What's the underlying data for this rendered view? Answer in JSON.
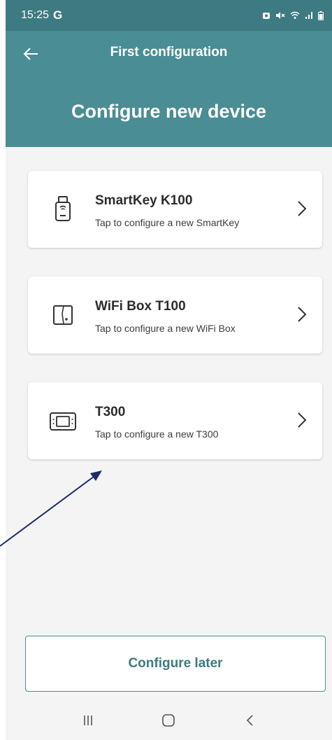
{
  "status_bar": {
    "time": "15:25",
    "g_label": "G",
    "icons": [
      "alarm-icon",
      "mute-icon",
      "wifi-icon",
      "signal-icon",
      "battery-icon"
    ]
  },
  "app_bar": {
    "title": "First configuration",
    "heading": "Configure new device",
    "color": "#4a8d94"
  },
  "devices": [
    {
      "icon": "smartkey-icon",
      "title": "SmartKey K100",
      "subtitle": "Tap to configure a new SmartKey"
    },
    {
      "icon": "wifi-box-icon",
      "title": "WiFi Box T100",
      "subtitle": "Tap to configure a new WiFi Box"
    },
    {
      "icon": "thermostat-icon",
      "title": "T300",
      "subtitle": "Tap to configure a new T300"
    }
  ],
  "configure_later_label": "Configure later",
  "nav_bar": {
    "icons": [
      "recent-apps-icon",
      "home-icon",
      "back-nav-icon"
    ]
  }
}
